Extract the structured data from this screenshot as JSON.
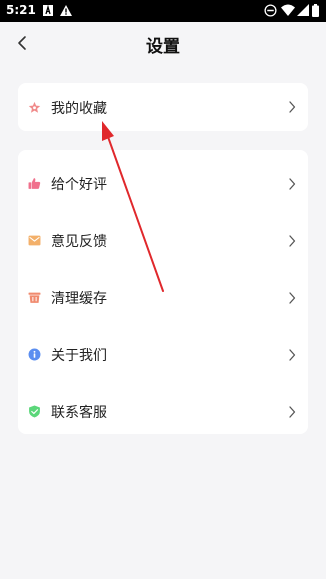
{
  "status_bar": {
    "time": "5:21"
  },
  "header": {
    "title": "设置"
  },
  "favorites": {
    "label": "我的收藏",
    "icon": "star-icon",
    "color": "#f08a8a"
  },
  "menu": [
    {
      "label": "给个好评",
      "icon": "thumbs-up-icon",
      "color": "#f0708c"
    },
    {
      "label": "意见反馈",
      "icon": "mail-icon",
      "color": "#f3b06a"
    },
    {
      "label": "清理缓存",
      "icon": "trash-icon",
      "color": "#f08a6e"
    },
    {
      "label": "关于我们",
      "icon": "info-icon",
      "color": "#5b8ef0"
    },
    {
      "label": "联系客服",
      "icon": "shield-check-icon",
      "color": "#5bd77a"
    }
  ],
  "colors": {
    "background": "#f5f5f7",
    "card": "#ffffff",
    "annotation_arrow": "#e0282c"
  }
}
